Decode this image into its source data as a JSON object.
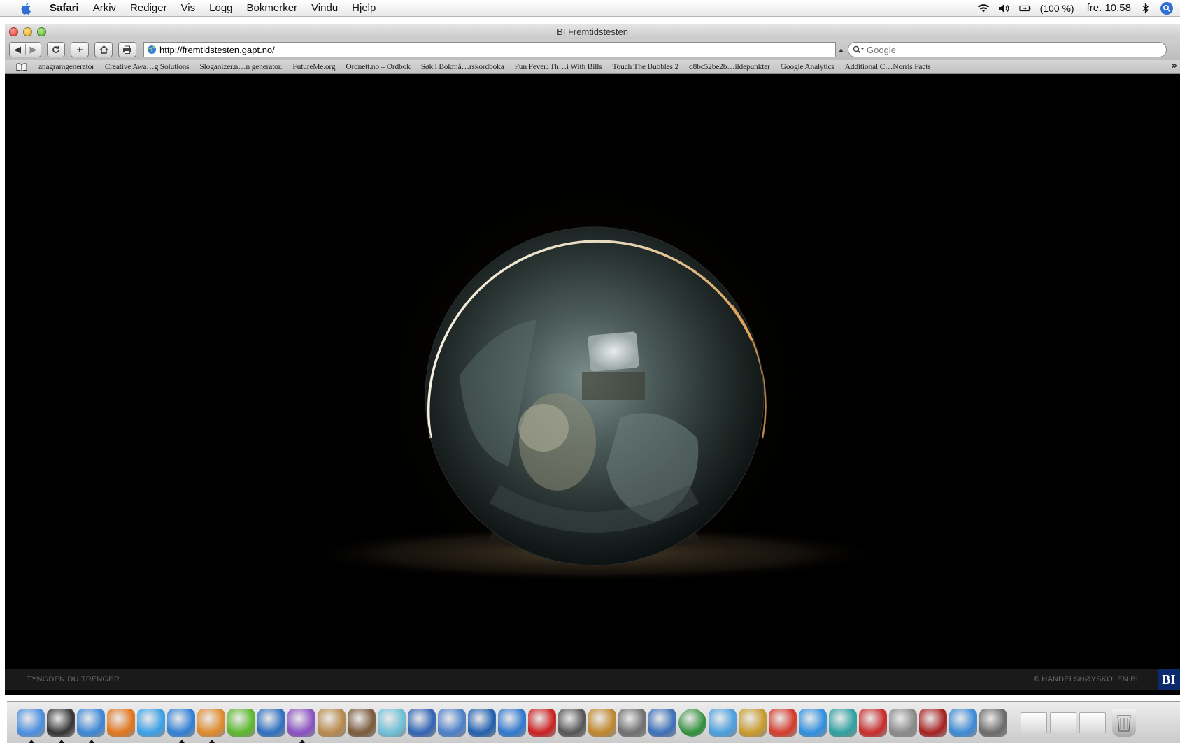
{
  "menubar": {
    "app_name": "Safari",
    "menus": [
      "Arkiv",
      "Rediger",
      "Vis",
      "Logg",
      "Bokmerker",
      "Vindu",
      "Hjelp"
    ],
    "battery": "(100 %)",
    "clock": "fre. 10.58"
  },
  "window": {
    "title": "BI Fremtidstesten",
    "url": "http://fremtidstesten.gapt.no/",
    "search_placeholder": "Google"
  },
  "bookmarks": [
    "anagramgenerator",
    "Creative Awa…g Solutions",
    "Sloganizer.n…n generator.",
    "FutureMe.org",
    "Ordnett.no – Ordbok",
    "Søk i Bokmå…rskordboka",
    "Fun Fever: Th…i With Bills",
    "Touch The Bubbles 2",
    "d8bc52be2b…ildepunkter",
    "Google Analytics",
    "Additional C…Norris Facts"
  ],
  "page": {
    "footer_left": "TYNGDEN DU TRENGER",
    "footer_right": "© HANDELSHØYSKOLEN BI",
    "logo": "BI"
  },
  "dock": {
    "icons": [
      {
        "name": "finder-icon",
        "color": "#4a8fe0",
        "running": true
      },
      {
        "name": "dashboard-icon",
        "color": "#333333",
        "running": true
      },
      {
        "name": "safari-icon",
        "color": "#3a86d6",
        "running": true
      },
      {
        "name": "firefox-icon",
        "color": "#e2751b",
        "running": false
      },
      {
        "name": "ichat-icon",
        "color": "#3aa0e8",
        "running": false
      },
      {
        "name": "word-icon",
        "color": "#2f7fd6",
        "running": true
      },
      {
        "name": "powerpoint-icon",
        "color": "#e08a2a",
        "running": true
      },
      {
        "name": "plants-icon",
        "color": "#5cb82c",
        "running": false
      },
      {
        "name": "compass-icon",
        "color": "#2d6fc0",
        "running": false
      },
      {
        "name": "entourage-icon",
        "color": "#8a4fc2",
        "running": true
      },
      {
        "name": "address-book-icon",
        "color": "#b8894a",
        "running": false
      },
      {
        "name": "iphoto-icon",
        "color": "#7a5a3a",
        "running": false
      },
      {
        "name": "hand-icon",
        "color": "#6fc0d8",
        "running": false
      },
      {
        "name": "imovie-icon",
        "color": "#2f63b4",
        "running": false
      },
      {
        "name": "voice-icon",
        "color": "#4a7fc8",
        "running": false
      },
      {
        "name": "google-earth-icon",
        "color": "#1f5fb0",
        "running": false
      },
      {
        "name": "idvd-icon",
        "color": "#2e78d0",
        "running": false
      },
      {
        "name": "opera-icon",
        "color": "#cc1f1f",
        "running": false
      },
      {
        "name": "sync-icon",
        "color": "#555555",
        "running": false
      },
      {
        "name": "garageband-icon",
        "color": "#c0862a",
        "running": false
      },
      {
        "name": "camera-icon",
        "color": "#6f6f6f",
        "running": false
      },
      {
        "name": "keynote-icon",
        "color": "#3a6fb8",
        "running": false
      },
      {
        "name": "wmv-icon",
        "color": "#2f8f3a",
        "running": false
      },
      {
        "name": "itunes-icon",
        "color": "#4a9fe0",
        "running": false
      },
      {
        "name": "cocktail-icon",
        "color": "#c89a2a",
        "running": false
      },
      {
        "name": "ical-icon",
        "color": "#d63a2a",
        "running": false
      },
      {
        "name": "quicktime-icon",
        "color": "#2f8fe0",
        "running": false
      },
      {
        "name": "feather-icon",
        "color": "#2fa0a0",
        "running": false
      },
      {
        "name": "acrobat-icon",
        "color": "#c82a2a",
        "running": false
      },
      {
        "name": "system-icon",
        "color": "#8a8a8a",
        "running": false
      },
      {
        "name": "photobooth-icon",
        "color": "#a82020",
        "running": false
      },
      {
        "name": "messenger-icon",
        "color": "#3a8ad6",
        "running": false
      },
      {
        "name": "printer-icon",
        "color": "#6a6a6a",
        "running": false
      }
    ],
    "minimized_count": 3,
    "trash": "trash-icon"
  }
}
